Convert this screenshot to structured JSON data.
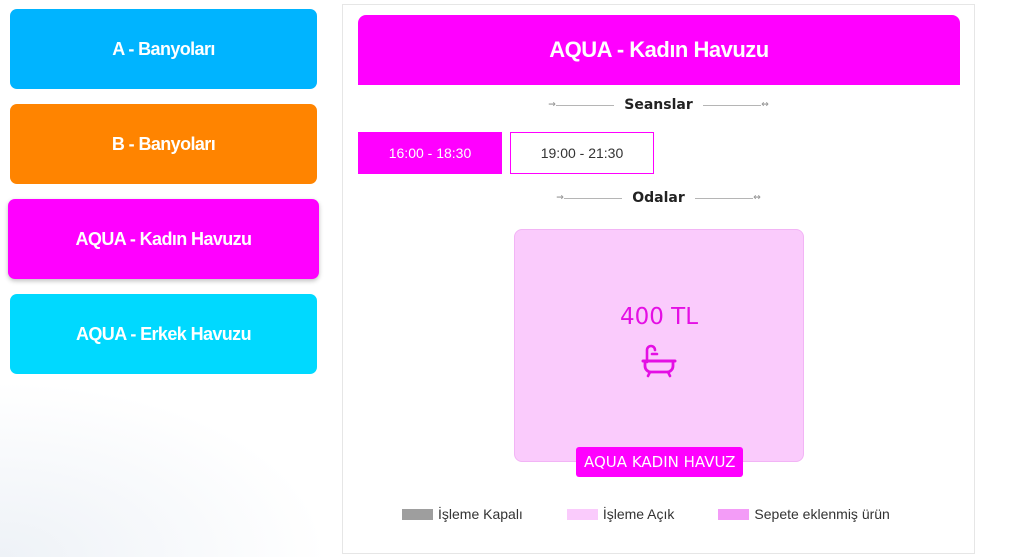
{
  "sidebar": {
    "items": [
      {
        "label": "A - Banyoları",
        "color": "#00b4ff"
      },
      {
        "label": "B - Banyoları",
        "color": "#ff8400"
      },
      {
        "label": "AQUA - Kadın Havuzu",
        "color": "#ff00ff",
        "active": true
      },
      {
        "label": "AQUA - Erkek Havuzu",
        "color": "#00d9ff"
      }
    ]
  },
  "panel": {
    "title": "AQUA - Kadın Havuzu",
    "title_color": "#ff00ff",
    "sessions_heading": "Seanslar",
    "rooms_heading": "Odalar",
    "sessions": [
      {
        "label": "16:00 - 18:30",
        "active": true
      },
      {
        "label": "19:00 - 21:30",
        "active": false
      }
    ],
    "room": {
      "price": "400 TL",
      "icon": "bathtub-icon",
      "label": "AQUA KADIN HAVUZ"
    }
  },
  "legend": [
    {
      "label": "İşleme Kapalı",
      "color": "#9e9e9e"
    },
    {
      "label": "İşleme Açık",
      "color": "#facbfc"
    },
    {
      "label": "Sepete eklenmiş ürün",
      "color": "#f39cf7"
    }
  ]
}
